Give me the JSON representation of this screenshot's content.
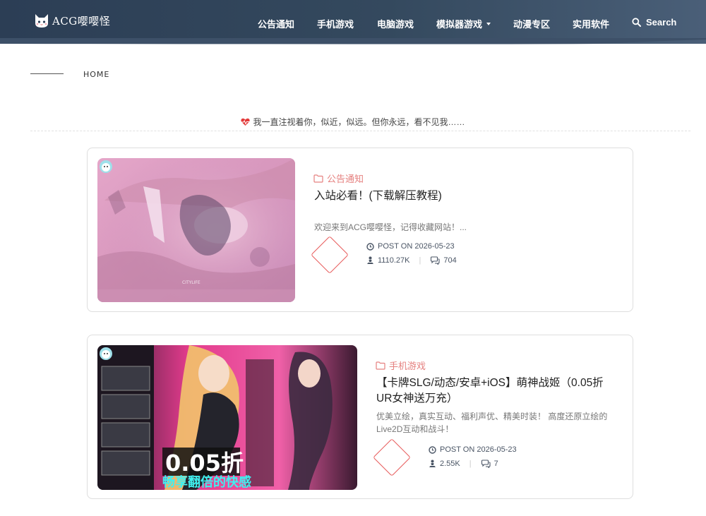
{
  "header": {
    "logo_text": "ACG嘤嘤怪",
    "nav": [
      {
        "label": "公告通知"
      },
      {
        "label": "手机游戏"
      },
      {
        "label": "电脑游戏"
      },
      {
        "label": "模拟器游戏",
        "has_dropdown": true
      },
      {
        "label": "动漫专区"
      },
      {
        "label": "实用软件"
      }
    ],
    "search_label": "Search"
  },
  "breadcrumb": {
    "label": "HOME"
  },
  "notice": {
    "text": "我一直注视着你，似近，似远。但你永远，看不见我……"
  },
  "posts": [
    {
      "category": "公告通知",
      "title": "入站必看！(下载解压教程)",
      "excerpt": "欢迎来到ACG嘤嘤怪，记得收藏网站！...",
      "date": "POST ON 2026-05-23",
      "views": "1110.27K",
      "comments": "704",
      "thumb_watermark": "CITYLIFE"
    },
    {
      "category": "手机游戏",
      "title": "【卡牌SLG/动态/安卓+iOS】萌神战姬（0.05折UR女神送万充）",
      "excerpt": "优美立绘，真实互动、福利声优、精美时装！ 高度还原立绘的Live2D互动和战斗！",
      "date": "POST ON 2026-05-23",
      "views": "2.55K",
      "comments": "7",
      "thumb_big_text": "0.05折",
      "thumb_sub_text": "畅享翻倍的快感"
    }
  ],
  "colors": {
    "header_bg": "#2c3e55",
    "accent": "#e5807f",
    "diamond": "#e85a5a"
  }
}
